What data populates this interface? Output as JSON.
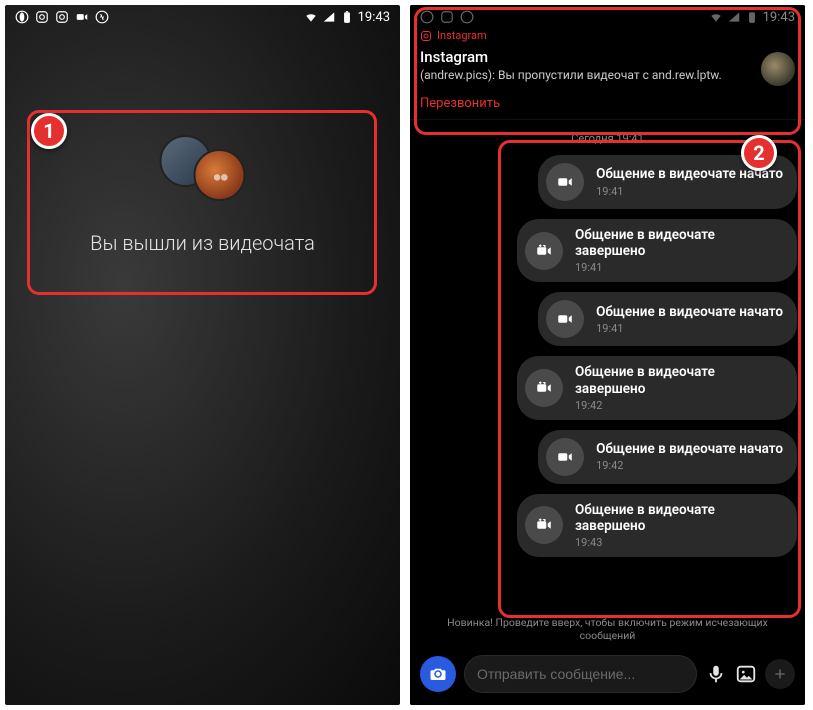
{
  "left": {
    "status_time": "19:43",
    "message": "Вы вышли из видеочата",
    "marker": "1"
  },
  "right": {
    "status_time": "19:43",
    "marker": "2",
    "notification": {
      "app": "Instagram",
      "title": "Instagram",
      "body": "(andrew.pics): Вы пропустили видеочат с and.rew.lptw.",
      "action": "Перезвонить"
    },
    "date_separator": "Сегодня 19:41",
    "messages": [
      {
        "icon": "video",
        "title": "Общение в видеочате начато",
        "time": "19:41"
      },
      {
        "icon": "video-end",
        "title": "Общение в видеочате завершено",
        "time": "19:41"
      },
      {
        "icon": "video",
        "title": "Общение в видеочате начато",
        "time": "19:41"
      },
      {
        "icon": "video-end",
        "title": "Общение в видеочате завершено",
        "time": "19:42"
      },
      {
        "icon": "video",
        "title": "Общение в видеочате начато",
        "time": "19:42"
      },
      {
        "icon": "video-end",
        "title": "Общение в видеочате завершено",
        "time": "19:43"
      }
    ],
    "hint": "Новинка! Проведите вверх, чтобы включить режим исчезающих сообщений",
    "composer_placeholder": "Отправить сообщение..."
  }
}
